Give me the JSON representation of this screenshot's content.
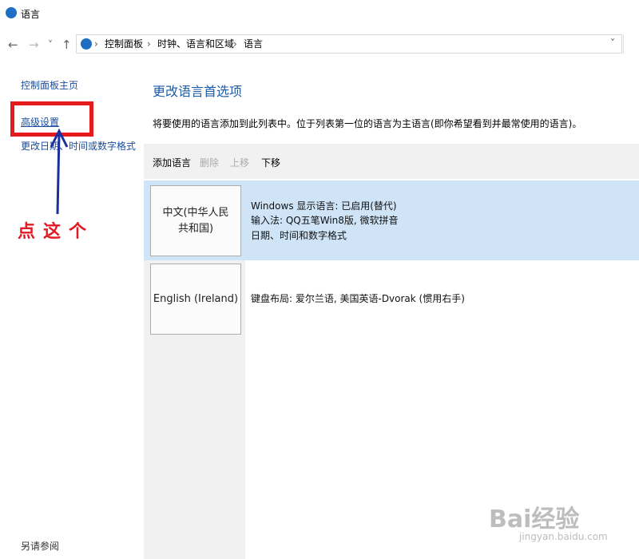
{
  "window": {
    "title": "语言"
  },
  "nav": {
    "back": "←",
    "forward": "→",
    "recent": "˅",
    "up": "↑"
  },
  "address": {
    "crumbs": [
      "控制面板",
      "时钟、语言和区域",
      "语言"
    ],
    "separator": "›",
    "dropdown": "˅"
  },
  "sidebar": {
    "home": "控制面板主页",
    "advanced": "高级设置",
    "datetime": "更改日期、时间或数字格式",
    "see_also": "另请参阅"
  },
  "main": {
    "heading": "更改语言首选项",
    "description": "将要使用的语言添加到此列表中。位于列表第一位的语言为主语言(即你希望看到并最常使用的语言)。"
  },
  "toolbar": {
    "add": "添加语言",
    "remove": "删除",
    "up": "上移",
    "down": "下移"
  },
  "languages": [
    {
      "name": "中文(中华人民共和国)",
      "details": [
        "Windows 显示语言: 已启用(替代)",
        "输入法: QQ五笔Win8版, 微软拼音",
        "日期、时间和数字格式"
      ]
    },
    {
      "name": "English (Ireland)",
      "details": [
        "键盘布局: 爱尔兰语, 美国英语-Dvorak (惯用右手)"
      ]
    }
  ],
  "annotation": {
    "text": "点这个",
    "color": "#e11a24"
  },
  "watermark": {
    "brand": "Bai经验",
    "url": "jingyan.baidu.com"
  },
  "colors": {
    "selection": "#cfe4f7",
    "link": "#1a4d9e",
    "heading": "#1e5aa6",
    "annotation": "#e51a1a"
  }
}
